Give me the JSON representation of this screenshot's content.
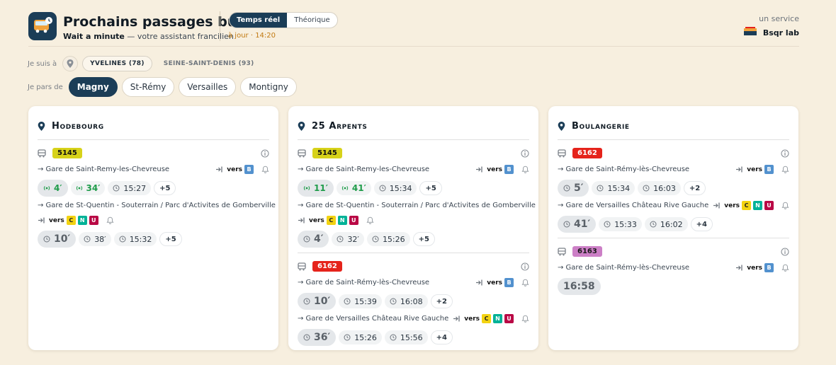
{
  "header": {
    "title": "Prochains passages bus",
    "subtitle_brand": "Wait a minute",
    "subtitle_rest": " — votre assistant francilien",
    "tabs": [
      "Temps réel",
      "Théorique"
    ],
    "update": "à jour · 14:20",
    "service_label": "un service",
    "brand_name": "Bsqr lab"
  },
  "filters": {
    "location_label": "Je suis à",
    "departments": [
      "YVELINES (78)",
      "SEINE-SAINT-DENIS (93)"
    ],
    "depart_label": "Je pars de",
    "cities": [
      "Magny",
      "St-Rémy",
      "Versailles",
      "Montigny"
    ]
  },
  "colors": {
    "accent": "#1b3d57",
    "realtime": "#1f9c4a",
    "update": "#c27a12"
  },
  "cards": [
    {
      "stop": "Hodebourg",
      "routes": [
        {
          "line": "5145",
          "dirs": [
            {
              "label": "→ Gare de Saint-Remy-les-Chevreuse",
              "vers": "vers",
              "rer": [
                "B"
              ],
              "times": [
                {
                  "t": "4′",
                  "kind": "rt-big"
                },
                {
                  "t": "34′",
                  "kind": "rt"
                },
                {
                  "t": "15:27",
                  "kind": "clock"
                },
                {
                  "t": "+5",
                  "kind": "more"
                }
              ]
            },
            {
              "label": "→ Gare de St-Quentin - Souterrain / Parc d'Activites de Gomberville",
              "vers": "vers",
              "rer": [
                "C",
                "N",
                "U"
              ],
              "times": [
                {
                  "t": "10′",
                  "kind": "big"
                },
                {
                  "t": "38′",
                  "kind": "clock"
                },
                {
                  "t": "15:32",
                  "kind": "clock"
                },
                {
                  "t": "+5",
                  "kind": "more"
                }
              ]
            }
          ]
        }
      ]
    },
    {
      "stop": "25 Arpents",
      "routes": [
        {
          "line": "5145",
          "dirs": [
            {
              "label": "→ Gare de Saint-Remy-les-Chevreuse",
              "vers": "vers",
              "rer": [
                "B"
              ],
              "times": [
                {
                  "t": "11′",
                  "kind": "rt-big"
                },
                {
                  "t": "41′",
                  "kind": "rt"
                },
                {
                  "t": "15:34",
                  "kind": "clock"
                },
                {
                  "t": "+5",
                  "kind": "more"
                }
              ]
            },
            {
              "label": "→ Gare de St-Quentin - Souterrain / Parc d'Activites de Gomberville",
              "vers": "vers",
              "rer": [
                "C",
                "N",
                "U"
              ],
              "times": [
                {
                  "t": "4′",
                  "kind": "big"
                },
                {
                  "t": "32′",
                  "kind": "clock"
                },
                {
                  "t": "15:26",
                  "kind": "clock"
                },
                {
                  "t": "+5",
                  "kind": "more"
                }
              ]
            }
          ]
        },
        {
          "line": "6162",
          "dirs": [
            {
              "label": "→ Gare de Saint-Rémy-lès-Chevreuse",
              "vers": "vers",
              "rer": [
                "B"
              ],
              "times": [
                {
                  "t": "10′",
                  "kind": "big"
                },
                {
                  "t": "15:39",
                  "kind": "clock"
                },
                {
                  "t": "16:08",
                  "kind": "clock"
                },
                {
                  "t": "+2",
                  "kind": "more"
                }
              ]
            },
            {
              "label": "→ Gare de Versailles Château Rive Gauche",
              "vers": "vers",
              "rer": [
                "C",
                "N",
                "U"
              ],
              "times": [
                {
                  "t": "36′",
                  "kind": "big"
                },
                {
                  "t": "15:26",
                  "kind": "clock"
                },
                {
                  "t": "15:56",
                  "kind": "clock"
                },
                {
                  "t": "+4",
                  "kind": "more"
                }
              ]
            }
          ]
        }
      ]
    },
    {
      "stop": "Boulangerie",
      "routes": [
        {
          "line": "6162",
          "dirs": [
            {
              "label": "→ Gare de Saint-Rémy-lès-Chevreuse",
              "vers": "vers",
              "rer": [
                "B"
              ],
              "times": [
                {
                  "t": "5′",
                  "kind": "big"
                },
                {
                  "t": "15:34",
                  "kind": "clock"
                },
                {
                  "t": "16:03",
                  "kind": "clock"
                },
                {
                  "t": "+2",
                  "kind": "more"
                }
              ]
            },
            {
              "label": "→ Gare de Versailles Château Rive Gauche",
              "vers": "vers",
              "rer": [
                "C",
                "N",
                "U"
              ],
              "times": [
                {
                  "t": "41′",
                  "kind": "big"
                },
                {
                  "t": "15:33",
                  "kind": "clock"
                },
                {
                  "t": "16:02",
                  "kind": "clock"
                },
                {
                  "t": "+4",
                  "kind": "more"
                }
              ]
            }
          ]
        },
        {
          "line": "6163",
          "dirs": [
            {
              "label": "→ Gare de Saint-Rémy-lès-Chevreuse",
              "vers": "vers",
              "rer": [
                "B"
              ],
              "times": [
                {
                  "t": "16:58",
                  "kind": "big-plain"
                }
              ]
            }
          ]
        }
      ]
    }
  ]
}
